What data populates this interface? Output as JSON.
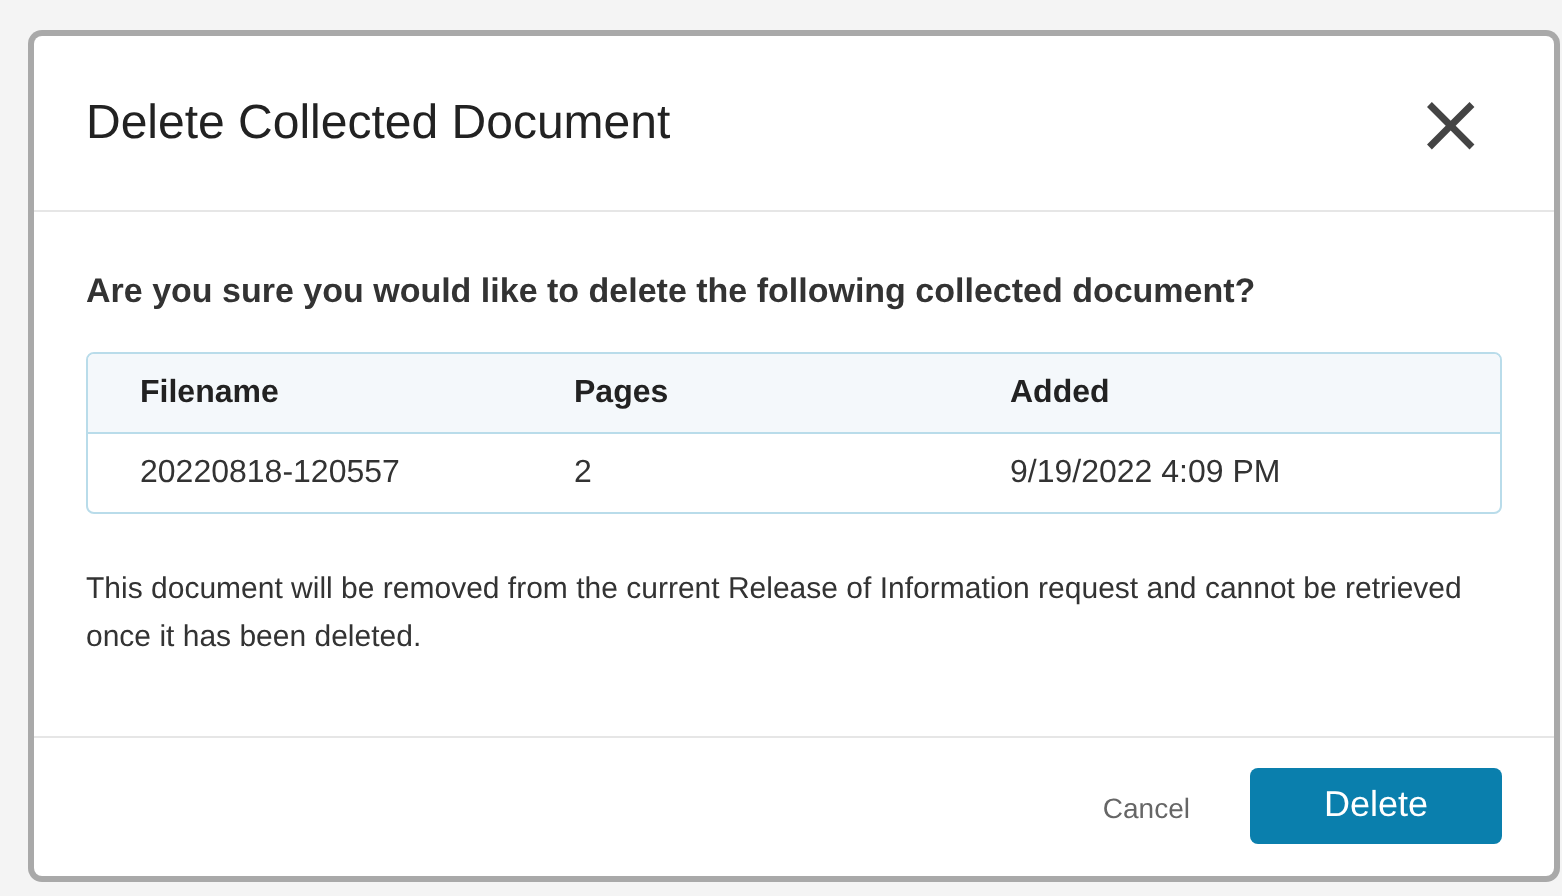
{
  "dialog": {
    "title": "Delete Collected Document",
    "close_icon": "×",
    "question": "Are you sure you would like to delete the following collected document?",
    "table": {
      "columns": [
        "Filename",
        "Pages",
        "Added"
      ],
      "rows": [
        [
          "20220818-120557",
          "2",
          "9/19/2022 4:09 PM"
        ]
      ]
    },
    "note": "This document will be removed from the current Release of Information request and cannot be retrieved once it has been deleted.",
    "buttons": [
      {
        "label": "Cancel",
        "kind": "link"
      },
      {
        "label": "Delete",
        "kind": "primary"
      }
    ]
  }
}
